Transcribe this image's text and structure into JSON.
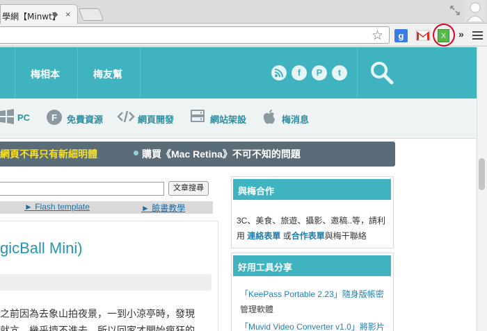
{
  "browser": {
    "tab_title": "學網【Minwt】",
    "tab_close": "×",
    "tab_mute": "◆",
    "extension_x_label": "X",
    "extension_google_label": "g",
    "overflow_chevron": "»",
    "icons": [
      "fullscreen-icon",
      "profile-icon",
      "star-icon",
      "google-extension-icon",
      "gmail-extension-icon",
      "x-extension-icon",
      "chevron-right-icon",
      "menu-icon"
    ],
    "highlight_color": "#e1001f"
  },
  "site": {
    "nav": [
      "梅相本",
      "梅友幫"
    ],
    "social": [
      "rss",
      "f",
      "P",
      "t"
    ],
    "categories": [
      {
        "icon": "windows-icon",
        "label": "PC"
      },
      {
        "icon": "free-resource-icon",
        "label": "免費資源"
      },
      {
        "icon": "code-icon",
        "label": "網頁開發"
      },
      {
        "icon": "server-icon",
        "label": "網站架設"
      },
      {
        "icon": "apple-icon",
        "label": "梅消息"
      }
    ],
    "ticker_a": "網頁不再只有新細明體",
    "ticker_b": "購買《Mac Retina》不可不知的問題",
    "accent": "#3fb3c0"
  },
  "main": {
    "search_button": "文章搜尋",
    "links": [
      "► Flash template",
      "► 臉書教學"
    ],
    "post_title": "gicBall Mini)",
    "post_body": [
      "之前因為去象山拍夜景，一到小涼亭時，發現",
      "就亢，幾乎擠不進去，所以回家才開始瘋狂的"
    ]
  },
  "sidebar": {
    "cooperation_title": "與梅合作",
    "cooperation_text_1": "3C、美食、旅遊、攝影、邀稿..等，請利",
    "cooperation_text_2": "用",
    "cooperation_link_1": "連絡表單",
    "cooperation_text_3": "或",
    "cooperation_link_2": "合作表單",
    "cooperation_text_4": "與梅干聯絡",
    "tools_title": "好用工具分享",
    "tools": [
      "「KeePass Portable 2.23」隨身版帳密",
      "管理軟體",
      "「Muvid Video Converter v1.0」將影片"
    ]
  }
}
